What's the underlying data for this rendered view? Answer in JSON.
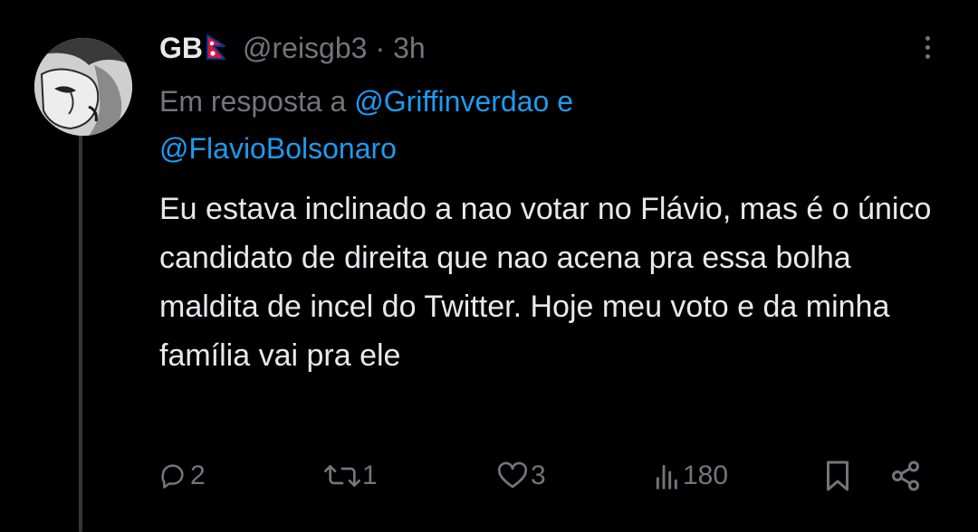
{
  "tweet": {
    "display_name": "GB",
    "handle": "@reisgb3",
    "separator": "·",
    "time": "3h",
    "reply_prefix": "Em resposta a",
    "mentions": [
      "@Griffinverdao",
      "@FlavioBolsonaro"
    ],
    "reply_conjunction": "e",
    "text": "Eu estava inclinado a nao votar no Flávio, mas é o único candidato de direita que nao acena pra essa bolha maldita de incel do Twitter. Hoje meu voto e da minha família vai pra ele"
  },
  "stats": {
    "replies": "2",
    "retweets": "1",
    "likes": "3",
    "views": "180"
  },
  "colors": {
    "background": "#000000",
    "text": "#e7e9ea",
    "secondary": "#71767b",
    "link": "#1d9bf0",
    "thread_line": "#333639"
  },
  "icons": [
    "flag-nepal-icon",
    "more-options-icon",
    "reply-icon",
    "retweet-icon",
    "like-icon",
    "views-icon",
    "bookmark-icon",
    "share-icon"
  ]
}
